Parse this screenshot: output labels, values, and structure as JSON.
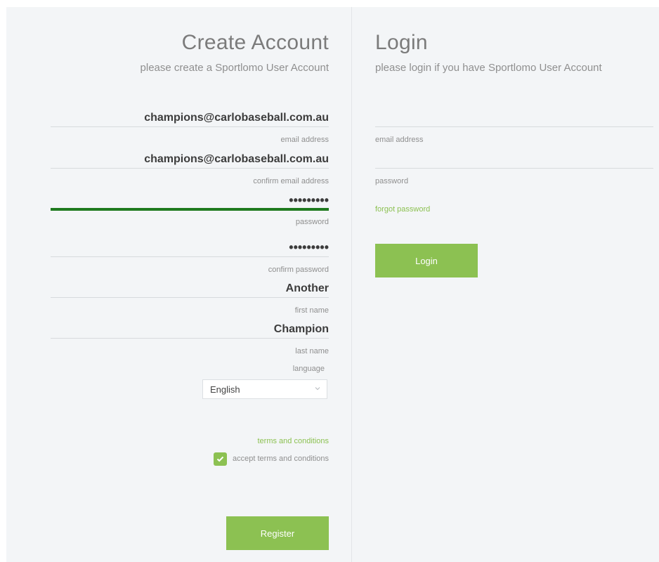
{
  "register": {
    "title": "Create Account",
    "subtitle": "please create a Sportlomo User Account",
    "email_value": "champions@carlobaseball.com.au",
    "email_label": "email address",
    "confirm_email_value": "champions@carlobaseball.com.au",
    "confirm_email_label": "confirm email address",
    "password_value": "•••••••••",
    "password_label": "password",
    "confirm_password_value": "•••••••••",
    "confirm_password_label": "confirm password",
    "first_name_value": "Another",
    "first_name_label": "first name",
    "last_name_value": "Champion",
    "last_name_label": "last name",
    "language_label": "language",
    "language_selected": "English",
    "terms_link": "terms and conditions",
    "accept_terms_label": "accept terms and conditions",
    "accept_terms_checked": true,
    "register_button": "Register"
  },
  "login": {
    "title": "Login",
    "subtitle": "please login if you have Sportlomo User Account",
    "email_label": "email address",
    "password_label": "password",
    "forgot_password": "forgot password",
    "login_button": "Login"
  },
  "colors": {
    "accent": "#8cc152",
    "password_strength": "#1f7a1f",
    "background": "#f3f5f7"
  },
  "icons": {
    "select_chevron": "chevron-down-icon",
    "checkbox_check": "check-icon"
  }
}
